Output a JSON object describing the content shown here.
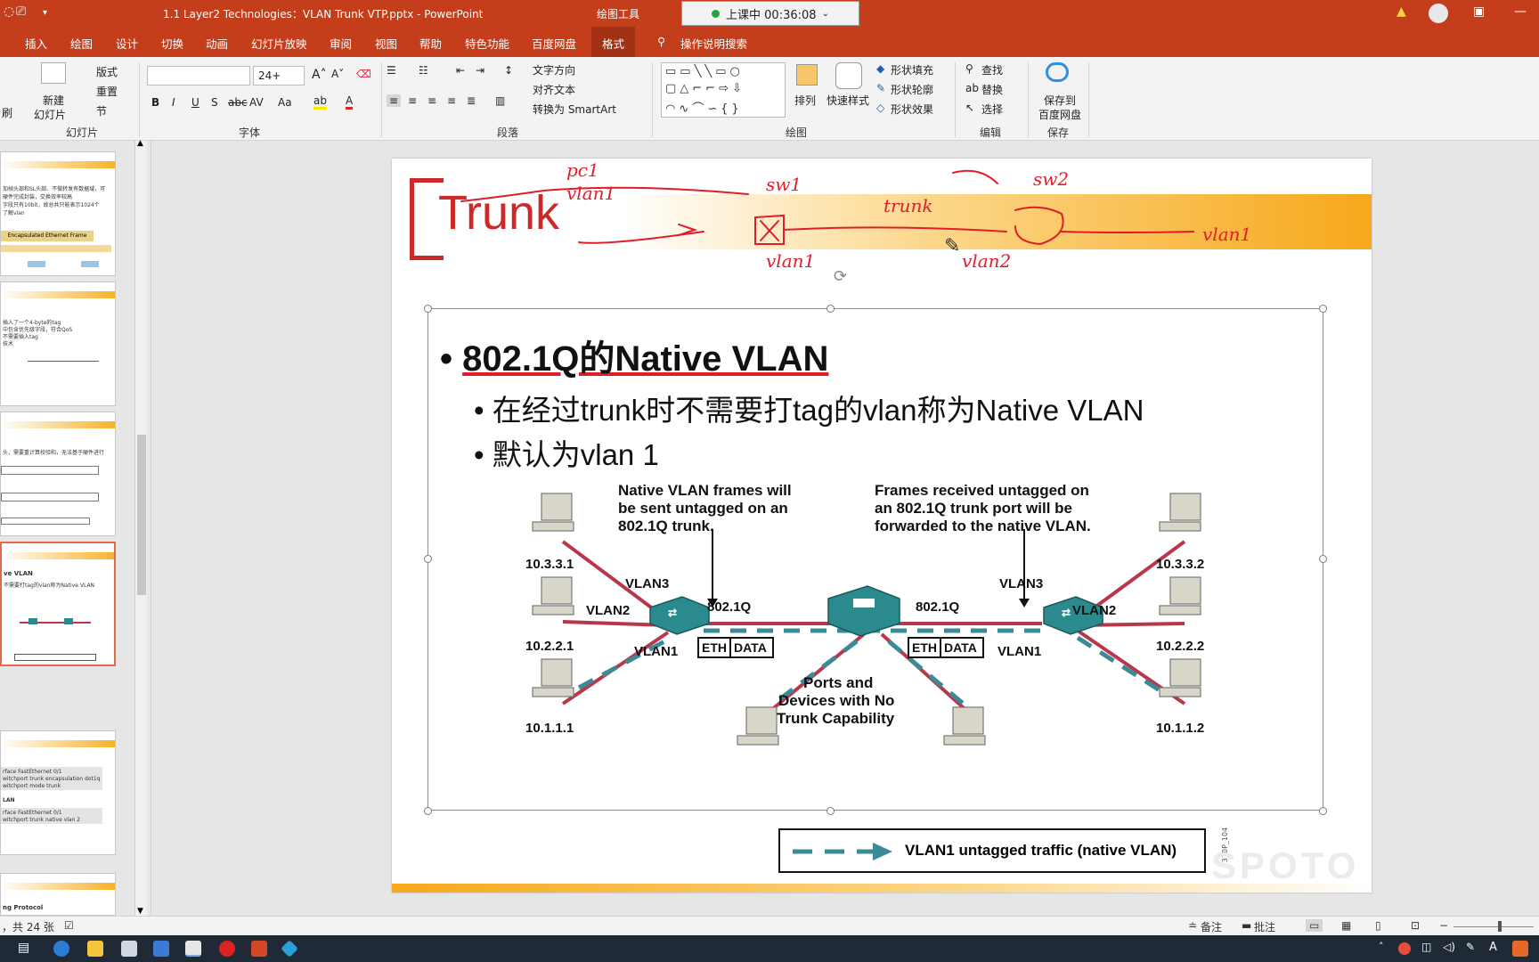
{
  "window": {
    "title": "1.1 Layer2 Technologies：VLAN Trunk VTP.pptx  -  PowerPoint",
    "context_tab_group": "绘图工具",
    "recording": "上课中 00:36:08"
  },
  "tabs": [
    "插入",
    "绘图",
    "设计",
    "切换",
    "动画",
    "幻灯片放映",
    "审阅",
    "视图",
    "帮助",
    "特色功能",
    "百度网盘",
    "格式"
  ],
  "tell_me": "操作说明搜索",
  "ribbon": {
    "slides": {
      "new_slide": "新建",
      "new_slide2": "幻灯片",
      "layout": "版式",
      "reset": "重置",
      "section": "节",
      "label": "幻灯片",
      "brush": "刷"
    },
    "font": {
      "size": "24+",
      "label": "字体"
    },
    "paragraph": {
      "text_direction": "文字方向",
      "align_text": "对齐文本",
      "smartart": "转换为 SmartArt",
      "label": "段落"
    },
    "drawing": {
      "arrange": "排列",
      "quick_styles": "快速样式",
      "fill": "形状填充",
      "outline": "形状轮廓",
      "effects": "形状效果",
      "label": "绘图"
    },
    "editing": {
      "find": "查找",
      "replace": "替换",
      "select": "选择",
      "label": "编辑"
    },
    "save": {
      "save_to": "保存到",
      "baidu": "百度网盘",
      "label": "保存"
    }
  },
  "thumbnails": [
    {
      "lines": [
        "加帧头部和SL头部、不做转发有数据域，可",
        "硬件完成封装，交换效率较高",
        "字段只有10bit，故总共只能表示1024个",
        "了解vlan"
      ],
      "frame_label": "Encapsulated Ethernet Frame"
    },
    {
      "lines": [
        "插入了一个4-byte的tag",
        "中包含优先级字段，符合QoS",
        "不需要插入tag",
        "技术"
      ]
    },
    {
      "lines": [
        "头，需要重计算校验和，无法基于硬件进行"
      ]
    },
    {
      "lines": [
        "ve VLAN",
        "不需要打tag的vlan称为Native VLAN"
      ]
    },
    {
      "lines": [
        "rface FastEthernet 0/1",
        "witchport trunk encapsulation dot1q",
        "witchport mode trunk",
        "LAN",
        "rface FastEthernet 0/1",
        "witchport trunk native vlan 2"
      ]
    },
    {
      "lines": [
        "ng Protocol"
      ]
    }
  ],
  "slide": {
    "title": "Trunk",
    "bullet1": "802.1Q的Native VLAN",
    "sub1": "在经过trunk时不需要打tag的vlan称为Native VLAN",
    "sub2": "默认为vlan 1",
    "legend": "VLAN1 untagged traffic (native VLAN)",
    "watermark": "SPOTO",
    "side_code": "310P_104"
  },
  "diagram": {
    "note_left": [
      "Native VLAN frames will",
      "be sent untagged on an",
      "802.1Q trunk."
    ],
    "note_right": [
      "Frames received untagged on",
      "an 802.1Q trunk port will be",
      "forwarded to the native VLAN."
    ],
    "center_note": [
      "Ports and",
      "Devices with No",
      "Trunk Capability"
    ],
    "hosts_left": [
      "10.3.3.1",
      "10.2.2.1",
      "10.1.1.1"
    ],
    "hosts_right": [
      "10.3.3.2",
      "10.2.2.2",
      "10.1.1.2"
    ],
    "vlan_labels": {
      "vlan3": "VLAN3",
      "vlan2": "VLAN2",
      "vlan1": "VLAN1"
    },
    "trunk_label": "802.1Q",
    "eth": "ETH",
    "data": "DATA"
  },
  "ink_annotations": [
    "pc1",
    "vlan1",
    "sw1",
    "trunk",
    "sw2",
    "vlan1",
    "vlan2",
    "vlan1"
  ],
  "status": {
    "slide_count": "，共 24 张",
    "notes": "备注",
    "comments": "批注"
  },
  "colors": {
    "accent": "#c43e1c",
    "title_red": "#cc2a2a",
    "link_red": "#b8374a",
    "native_teal": "#3a8a98",
    "ink": "#e01e2a"
  }
}
